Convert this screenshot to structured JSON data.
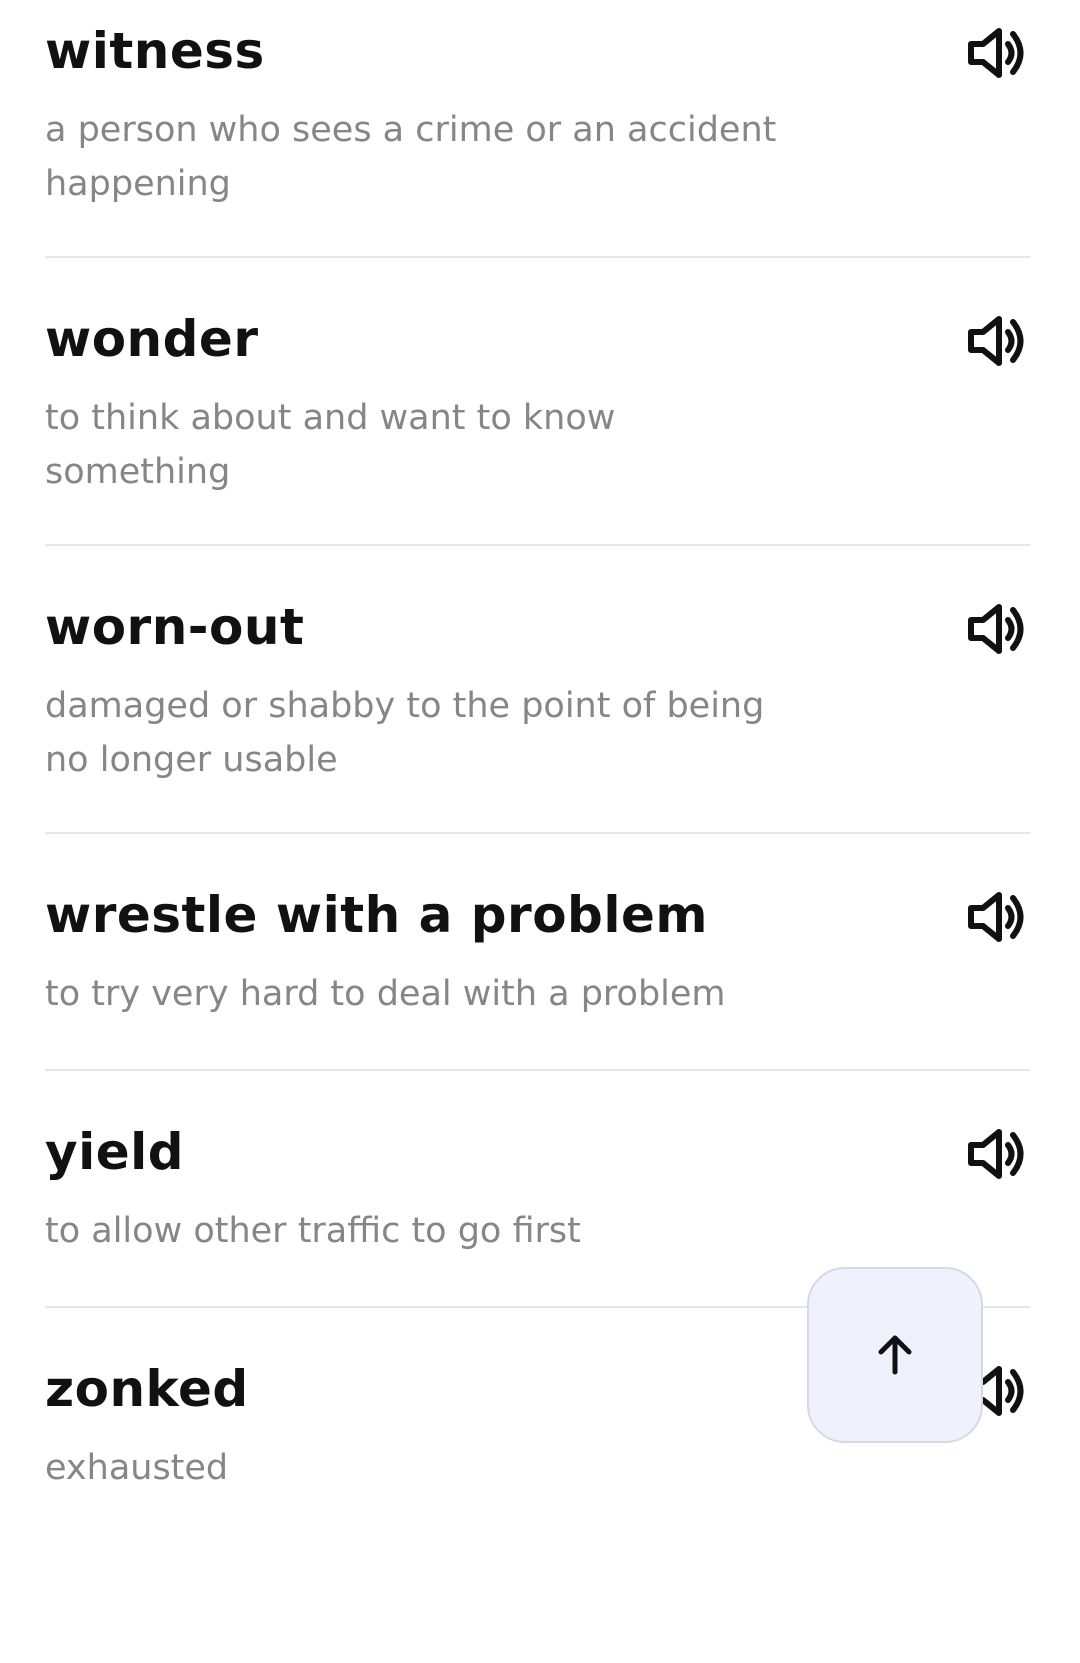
{
  "glossary": {
    "entries": [
      {
        "term": "witness",
        "definition": "a person who sees a crime or an accident happening",
        "audio_icon": "speaker-icon"
      },
      {
        "term": "wonder",
        "definition": "to think about and want to know something",
        "audio_icon": "speaker-icon"
      },
      {
        "term": "worn-out",
        "definition": "damaged or shabby to the point of being no longer usable",
        "audio_icon": "speaker-icon"
      },
      {
        "term": "wrestle with a problem",
        "definition": "to try very hard to deal with a problem",
        "audio_icon": "speaker-icon"
      },
      {
        "term": "yield",
        "definition": "to allow other traffic to go first",
        "audio_icon": "speaker-icon"
      },
      {
        "term": "zonked",
        "definition": "exhausted",
        "audio_icon": "speaker-icon"
      }
    ]
  },
  "scroll_top_button": {
    "icon": "arrow-up-icon",
    "background": "#eff2fd"
  },
  "colors": {
    "term": "#111111",
    "definition": "#868686",
    "divider": "#e6e6e9"
  }
}
